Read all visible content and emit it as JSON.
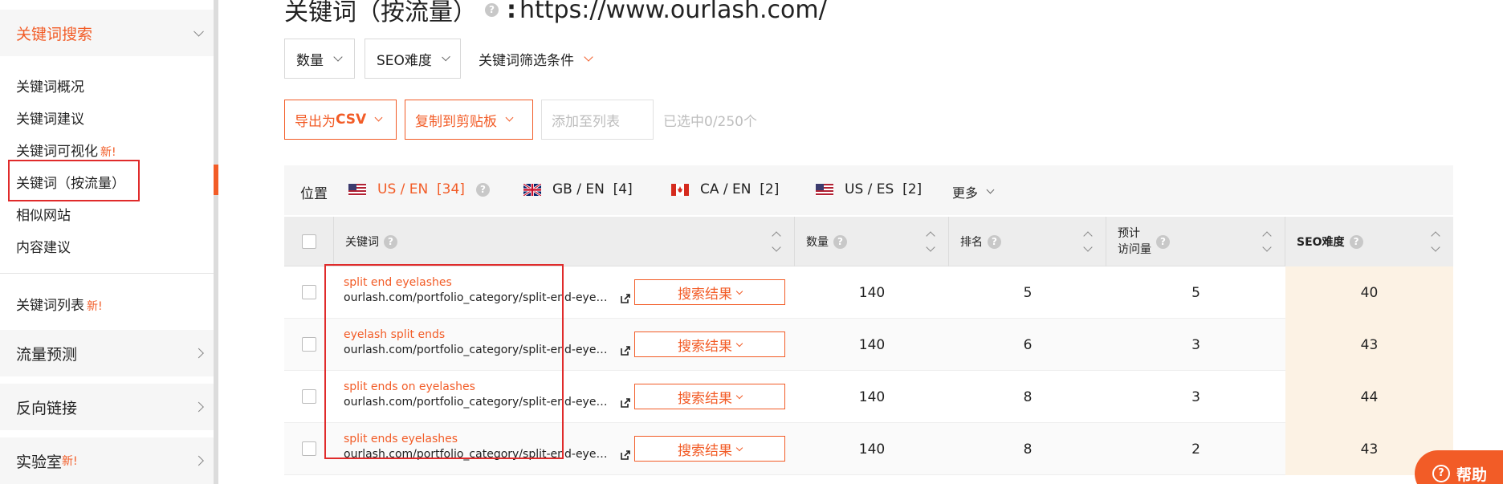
{
  "sidebar": {
    "section_keyword_search": "关键词搜索",
    "items": [
      {
        "label": "关键词概况"
      },
      {
        "label": "关键词建议"
      },
      {
        "label": "关键词可视化",
        "tag": "新!"
      },
      {
        "label": "关键词（按流量）"
      },
      {
        "label": "相似网站"
      },
      {
        "label": "内容建议"
      }
    ],
    "keyword_list": {
      "label": "关键词列表",
      "tag": "新!"
    },
    "sections": [
      {
        "label": "流量预测"
      },
      {
        "label": "反向链接"
      },
      {
        "label": "实验室",
        "tag": "新!"
      }
    ]
  },
  "header": {
    "title": "关键词（按流量）",
    "colon": ":",
    "url": "https://www.ourlash.com/"
  },
  "filters": {
    "volume": "数量",
    "seo_difficulty": "SEO难度",
    "keyword_filters": "关键词筛选条件"
  },
  "actions": {
    "export_prefix": "导出为",
    "export_bold": "CSV",
    "copy": "复制到剪贴板",
    "add_to_list": "添加至列表",
    "selected": "已选中0/250个"
  },
  "locations": {
    "label": "位置",
    "tabs": [
      {
        "label": "US / EN  [34]",
        "flag": "us-flag"
      },
      {
        "label": "GB / EN  [4]",
        "flag": "gb-flag"
      },
      {
        "label": "CA / EN  [2]",
        "flag": "ca-flag"
      },
      {
        "label": "US / ES  [2]",
        "flag": "us-flag"
      }
    ],
    "more": "更多"
  },
  "table": {
    "headers": {
      "keyword": "关键词",
      "volume": "数量",
      "rank": "排名",
      "est_visits_line1": "预计",
      "est_visits_line2": "访问量",
      "seo": "SEO难度"
    },
    "serp_label": "搜索结果",
    "rows": [
      {
        "keyword": "split end eyelashes",
        "url": "ourlash.com/portfolio_category/split-end-eyelashes/",
        "volume": "140",
        "rank": "5",
        "visits": "5",
        "seo": "40"
      },
      {
        "keyword": "eyelash split ends",
        "url": "ourlash.com/portfolio_category/split-end-eyelashes/",
        "volume": "140",
        "rank": "6",
        "visits": "3",
        "seo": "43"
      },
      {
        "keyword": "split ends on eyelashes",
        "url": "ourlash.com/portfolio_category/split-end-eyelashes/",
        "volume": "140",
        "rank": "8",
        "visits": "3",
        "seo": "44"
      },
      {
        "keyword": "split ends eyelashes",
        "url": "ourlash.com/portfolio_category/split-end-eyelashes/",
        "volume": "140",
        "rank": "8",
        "visits": "2",
        "seo": "43"
      }
    ]
  },
  "help_button": "帮助",
  "colors": {
    "accent": "#f25c27",
    "highlight": "#e02b2b",
    "seo_bg": "#fcf2e4"
  }
}
